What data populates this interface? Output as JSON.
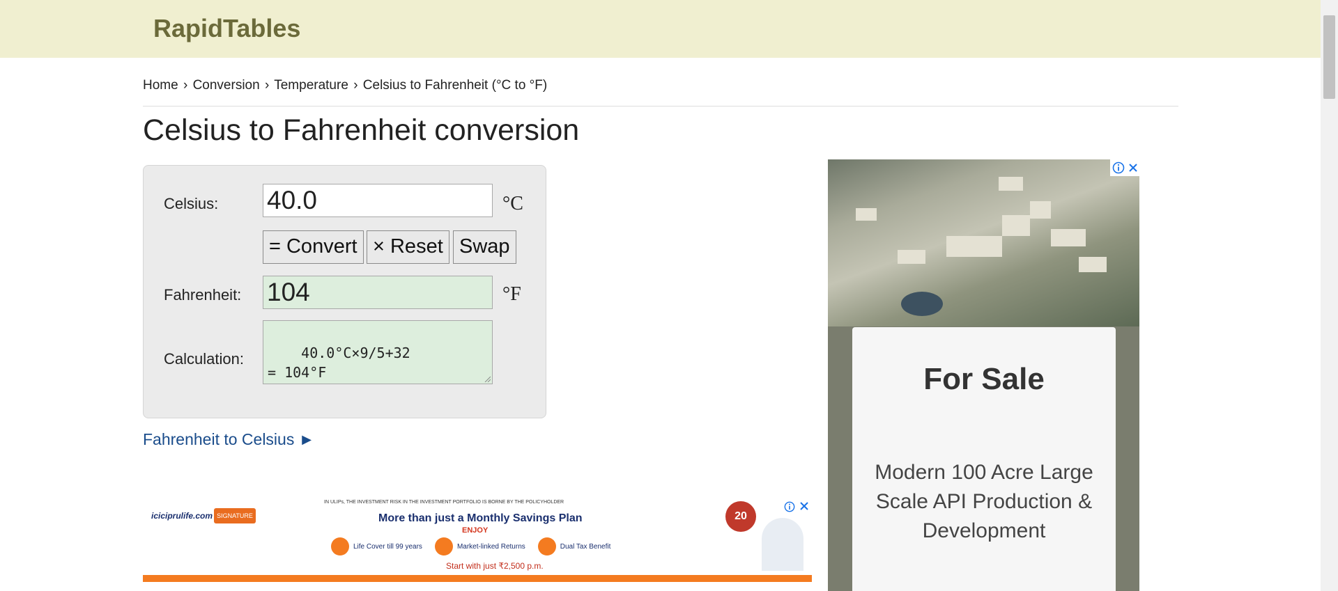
{
  "header": {
    "logo": "RapidTables"
  },
  "breadcrumb": {
    "home": "Home",
    "conversion": "Conversion",
    "temperature": "Temperature",
    "current": "Celsius to Fahrenheit (°C to °F)",
    "separator": "›"
  },
  "page_title": "Celsius to Fahrenheit conversion",
  "converter": {
    "celsius_label": "Celsius:",
    "celsius_value": "40.0",
    "celsius_unit": "°C",
    "convert_label": "= Convert",
    "reset_label": "× Reset",
    "swap_label": "Swap",
    "fahrenheit_label": "Fahrenheit:",
    "fahrenheit_value": "104",
    "fahrenheit_unit": "°F",
    "calculation_label": "Calculation:",
    "calculation_value": "40.0°C×9/5+32\n= 104°F"
  },
  "links": {
    "fahrenheit_to_celsius": "Fahrenheit to Celsius ►"
  },
  "ads": {
    "right": {
      "title": "For Sale",
      "description": "Modern 100 Acre Large Scale API Production & Development"
    },
    "bottom": {
      "brand": "iciciprulife.com",
      "badge": "SIGNATURE",
      "disclaimer": "IN ULIPs, THE INVESTMENT RISK IN THE INVESTMENT PORTFOLIO IS BORNE BY THE POLICYHOLDER",
      "headline": "More than just a Monthly Savings Plan",
      "enjoy": "ENJOY",
      "benefits": [
        "Life Cover till 99 years",
        "Market-linked Returns",
        "Dual Tax Benefit"
      ],
      "offer": "Start with just ₹2,500 p.m.",
      "years": "20"
    }
  },
  "colors": {
    "header_bg": "#f0efd0",
    "logo": "#6b6a3a",
    "link": "#1a4c8b",
    "output_bg": "#ddeedd",
    "ad_orange": "#f47b20"
  }
}
